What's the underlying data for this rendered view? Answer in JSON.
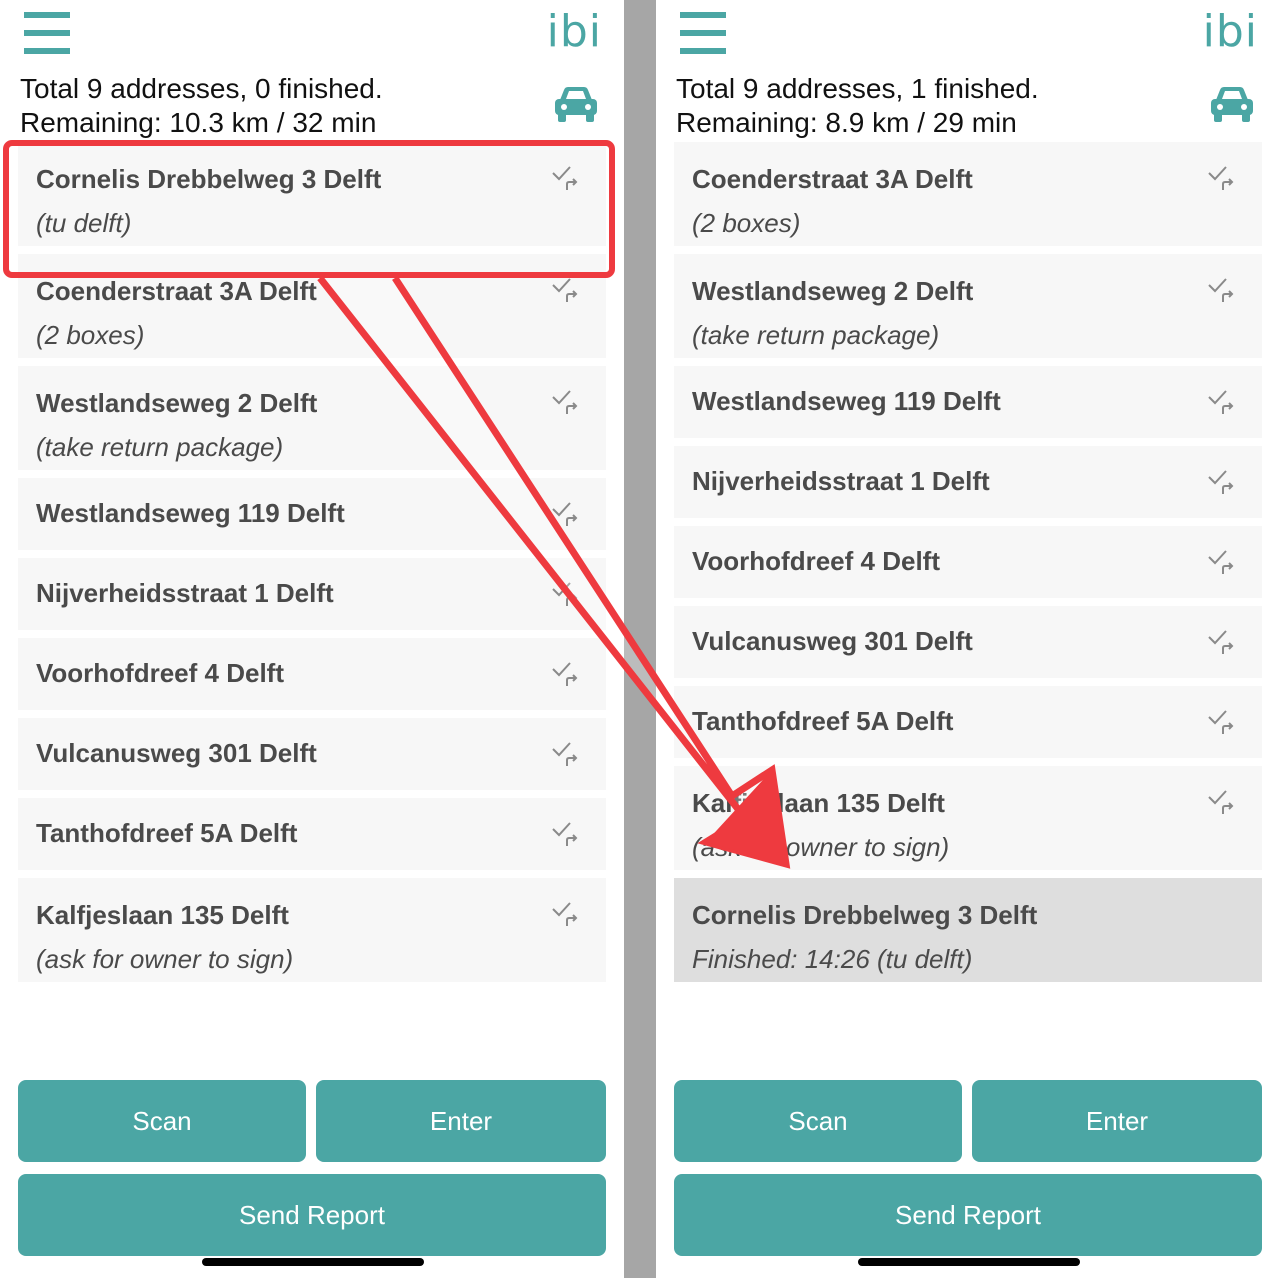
{
  "brand": "ibi",
  "colors": {
    "accent": "#4ba6a4",
    "annotation": "#ee3a3f"
  },
  "left": {
    "summary_line1": "Total 9 addresses, 0 finished.",
    "summary_line2": "Remaining: 10.3 km / 32 min",
    "items": [
      {
        "address": "Cornelis Drebbelweg 3 Delft",
        "note": "(tu delft)"
      },
      {
        "address": "Coenderstraat 3A Delft",
        "note": "(2 boxes)"
      },
      {
        "address": "Westlandseweg 2 Delft",
        "note": "(take return package)"
      },
      {
        "address": "Westlandseweg 119 Delft"
      },
      {
        "address": "Nijverheidsstraat 1 Delft"
      },
      {
        "address": "Voorhofdreef 4 Delft"
      },
      {
        "address": "Vulcanusweg 301 Delft"
      },
      {
        "address": "Tanthofdreef 5A Delft"
      },
      {
        "address": "Kalfjeslaan 135 Delft",
        "note": "(ask for owner to sign)"
      }
    ],
    "buttons": {
      "scan": "Scan",
      "enter": "Enter",
      "send_report": "Send Report"
    }
  },
  "right": {
    "summary_line1": "Total 9 addresses, 1 finished.",
    "summary_line2": "Remaining: 8.9 km / 29 min",
    "items": [
      {
        "address": "Coenderstraat 3A Delft",
        "note": "(2 boxes)"
      },
      {
        "address": "Westlandseweg 2 Delft",
        "note": "(take return package)"
      },
      {
        "address": "Westlandseweg 119 Delft"
      },
      {
        "address": "Nijverheidsstraat 1 Delft"
      },
      {
        "address": "Voorhofdreef 4 Delft"
      },
      {
        "address": "Vulcanusweg 301 Delft"
      },
      {
        "address": "Tanthofdreef 5A Delft"
      },
      {
        "address": "Kalfjeslaan 135 Delft",
        "note": "(ask for owner to sign)"
      },
      {
        "address": "Cornelis Drebbelweg 3 Delft",
        "note": "Finished: 14:26 (tu delft)",
        "finished": true
      }
    ],
    "buttons": {
      "scan": "Scan",
      "enter": "Enter",
      "send_report": "Send Report"
    }
  },
  "icons": {
    "menu": "hamburger-menu-icon",
    "vehicle": "car-icon",
    "row_action": "check-forward-icon"
  }
}
